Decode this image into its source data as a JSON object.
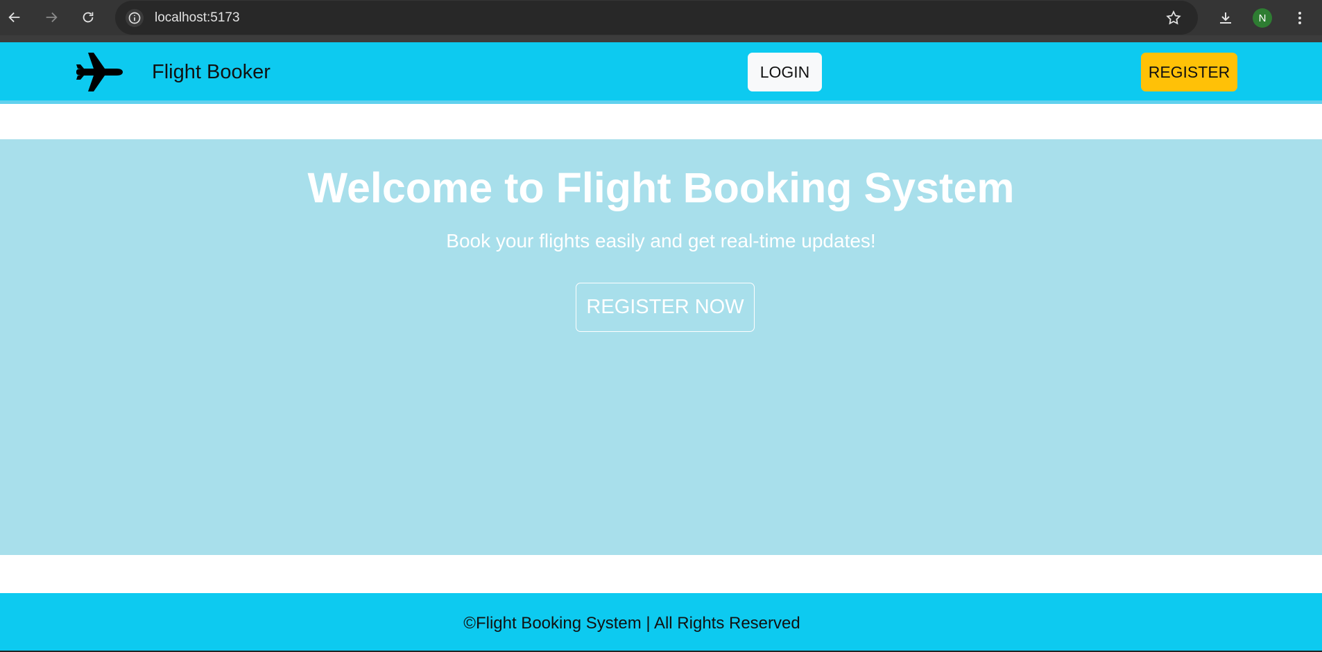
{
  "browser": {
    "url": "localhost:5173",
    "profile_initial": "N",
    "icons": [
      "back-icon",
      "forward-icon",
      "reload-icon",
      "site-info-icon",
      "bookmark-star-icon",
      "download-icon",
      "menu-icon"
    ]
  },
  "header": {
    "brand_name": "Flight Booker",
    "brand_icon": "airplane-icon",
    "login_label": "LOGIN",
    "register_label": "REGISTER"
  },
  "hero": {
    "title": "Welcome to Flight Booking System",
    "subtitle": "Book your flights easily and get real-time updates!",
    "cta_label": "REGISTER NOW"
  },
  "footer": {
    "text": "©Flight Booking System | All Rights Reserved"
  },
  "colors": {
    "header_bg": "#0dcaf0",
    "hero_bg": "#a8dfeb",
    "login_bg": "#f8f9fa",
    "register_bg": "#ffc107",
    "footer_bg": "#0dcaf0"
  }
}
